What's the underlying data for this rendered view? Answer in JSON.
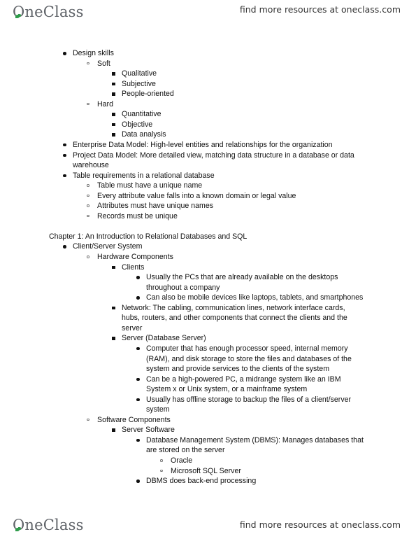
{
  "header": {
    "brand": "OneClass",
    "resources_link": "find more resources at oneclass.com"
  },
  "footer": {
    "brand": "OneClass",
    "resources_link": "find more resources at oneclass.com"
  },
  "lines": [
    {
      "level": 1,
      "bullet": "disc",
      "text": "Design skills"
    },
    {
      "level": 2,
      "bullet": "circle",
      "text": "Soft"
    },
    {
      "level": 3,
      "bullet": "square",
      "text": "Qualitative"
    },
    {
      "level": 3,
      "bullet": "square",
      "text": "Subjective"
    },
    {
      "level": 3,
      "bullet": "square",
      "text": "People-oriented"
    },
    {
      "level": 2,
      "bullet": "circle",
      "text": "Hard"
    },
    {
      "level": 3,
      "bullet": "square",
      "text": "Quantitative"
    },
    {
      "level": 3,
      "bullet": "square",
      "text": "Objective"
    },
    {
      "level": 3,
      "bullet": "square",
      "text": "Data analysis"
    },
    {
      "level": 1,
      "bullet": "disc",
      "text": "Enterprise Data Model: High-level entities and relationships for the organization"
    },
    {
      "level": 1,
      "bullet": "disc",
      "text": "Project Data Model: More detailed view, matching data structure in a database or data"
    },
    {
      "level": 1,
      "bullet": "none",
      "text": "warehouse"
    },
    {
      "level": 1,
      "bullet": "disc",
      "text": "Table requirements in a relational database"
    },
    {
      "level": 2,
      "bullet": "circle",
      "text": "Table must have a unique name"
    },
    {
      "level": 2,
      "bullet": "circle",
      "text": "Every attribute value falls into a known domain or legal value"
    },
    {
      "level": 2,
      "bullet": "circle",
      "text": "Attributes must have unique names"
    },
    {
      "level": 2,
      "bullet": "circle",
      "text": "Records must be unique"
    },
    {
      "level": 0,
      "bullet": "blank",
      "text": ""
    },
    {
      "level": 0,
      "bullet": "none",
      "text": "Chapter 1: An Introduction to Relational Databases and SQL"
    },
    {
      "level": 1,
      "bullet": "disc",
      "text": "Client/Server System"
    },
    {
      "level": 2,
      "bullet": "circle",
      "text": "Hardware Components"
    },
    {
      "level": 3,
      "bullet": "square",
      "text": "Clients"
    },
    {
      "level": 4,
      "bullet": "disc",
      "text": "Usually the PCs that are already available on the desktops"
    },
    {
      "level": 4,
      "bullet": "none",
      "text": "throughout a company"
    },
    {
      "level": 4,
      "bullet": "disc",
      "text": "Can also be mobile devices like laptops, tablets, and smartphones"
    },
    {
      "level": 3,
      "bullet": "square",
      "text": "Network: The cabling, communication lines, network interface cards,"
    },
    {
      "level": 3,
      "bullet": "none",
      "text": "hubs, routers, and other components that connect the clients and the"
    },
    {
      "level": 3,
      "bullet": "none",
      "text": "server"
    },
    {
      "level": 3,
      "bullet": "square",
      "text": "Server (Database Server)"
    },
    {
      "level": 4,
      "bullet": "disc",
      "text": "Computer that has enough processor speed, internal memory"
    },
    {
      "level": 4,
      "bullet": "none",
      "text": "(RAM), and disk storage to store the files and databases of the"
    },
    {
      "level": 4,
      "bullet": "none",
      "text": "system and provide services to the clients of the system"
    },
    {
      "level": 4,
      "bullet": "disc",
      "text": "Can be a high-powered PC, a midrange system like an IBM"
    },
    {
      "level": 4,
      "bullet": "none",
      "text": "System x or Unix system, or a mainframe system"
    },
    {
      "level": 4,
      "bullet": "disc",
      "text": "Usually has offline storage to backup the files of a client/server"
    },
    {
      "level": 4,
      "bullet": "none",
      "text": "system"
    },
    {
      "level": 2,
      "bullet": "circle",
      "text": "Software Components"
    },
    {
      "level": 3,
      "bullet": "square",
      "text": "Server Software"
    },
    {
      "level": 4,
      "bullet": "disc",
      "text": "Database Management System (DBMS): Manages databases that"
    },
    {
      "level": 4,
      "bullet": "none",
      "text": "are stored on the server"
    },
    {
      "level": 5,
      "bullet": "circle",
      "text": "Oracle"
    },
    {
      "level": 5,
      "bullet": "circle",
      "text": "Microsoft SQL Server"
    },
    {
      "level": 4,
      "bullet": "disc",
      "text": "DBMS does back-end processing"
    }
  ]
}
